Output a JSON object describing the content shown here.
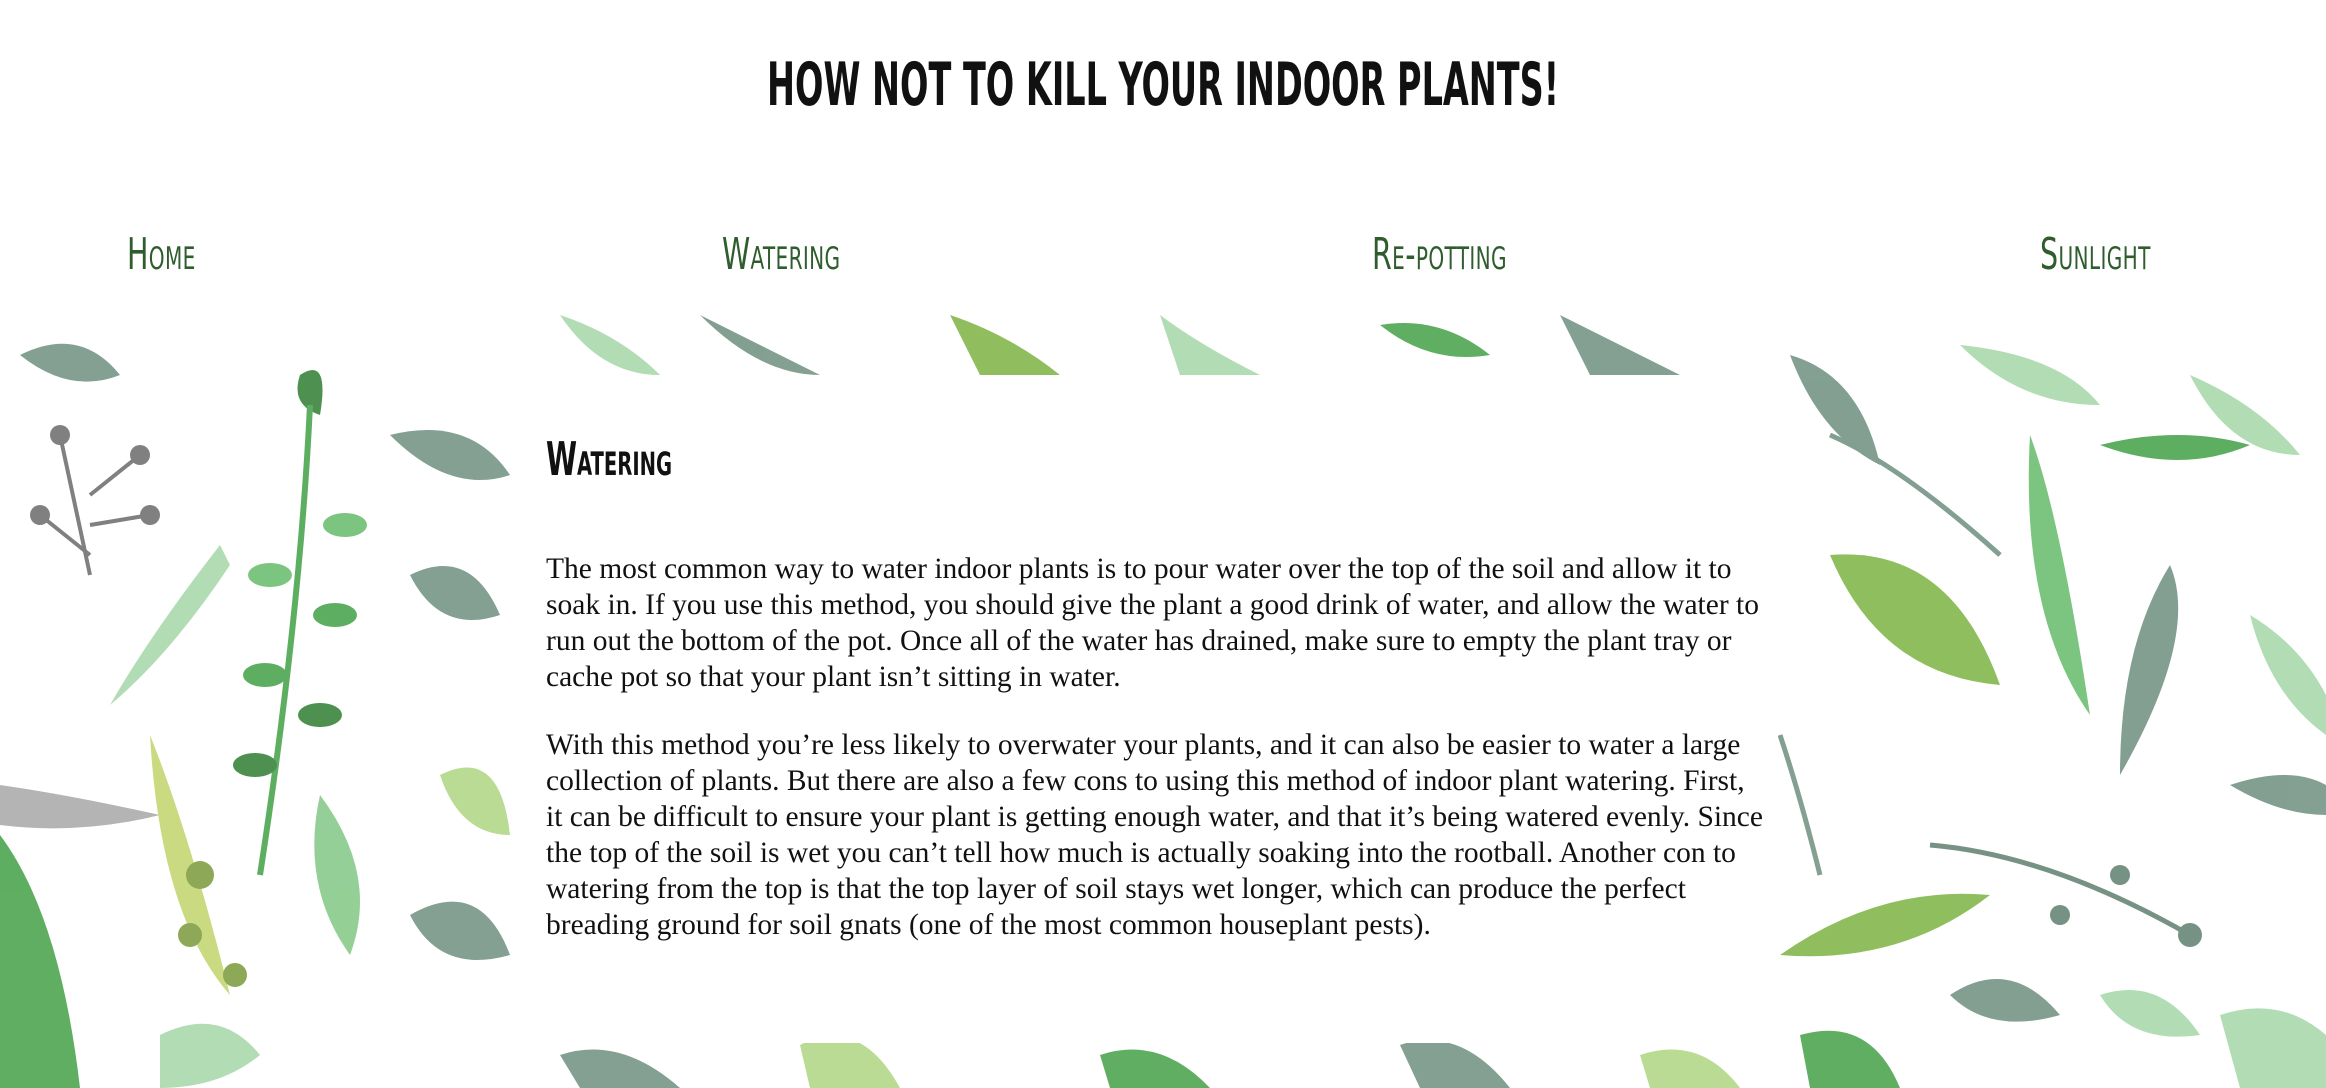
{
  "header": {
    "title": "HOW NOT TO KILL YOUR INDOOR PLANTS!"
  },
  "nav": {
    "items": [
      {
        "label": "Home"
      },
      {
        "label": "Watering"
      },
      {
        "label": "Re-potting"
      },
      {
        "label": "Sunlight"
      }
    ]
  },
  "main": {
    "heading": "Watering",
    "paragraphs": [
      "The most common way to water indoor plants is to pour water over the top of the soil and allow it to soak in. If you use this method, you should give the plant a good drink of water, and allow the water to run out the bottom of the pot. Once all of the water has drained, make sure to empty the plant tray or cache pot so that your plant isn’t sitting in water.",
      "With this method you’re less likely to overwater your plants, and it can also be easier to water a large collection of plants. But there are also a few cons to using this method of indoor plant watering. First, it can be difficult to ensure your plant is getting enough water, and that it’s being watered evenly. Since the top of the soil is wet you can’t tell how much is actually soaking into the rootball. Another con to watering from the top is that the top layer of soil stays wet longer, which can produce the perfect breading ground for soil gnats (one of the most common houseplant pests)."
    ]
  },
  "colors": {
    "nav_text": "#2f5d2e",
    "leaf_dark": "#2e7d32",
    "leaf_mid": "#66bb6a",
    "leaf_light": "#a5d6a7",
    "leaf_gray": "#6d8f80"
  },
  "background": {
    "icon": "watercolor-leaves-pattern"
  }
}
